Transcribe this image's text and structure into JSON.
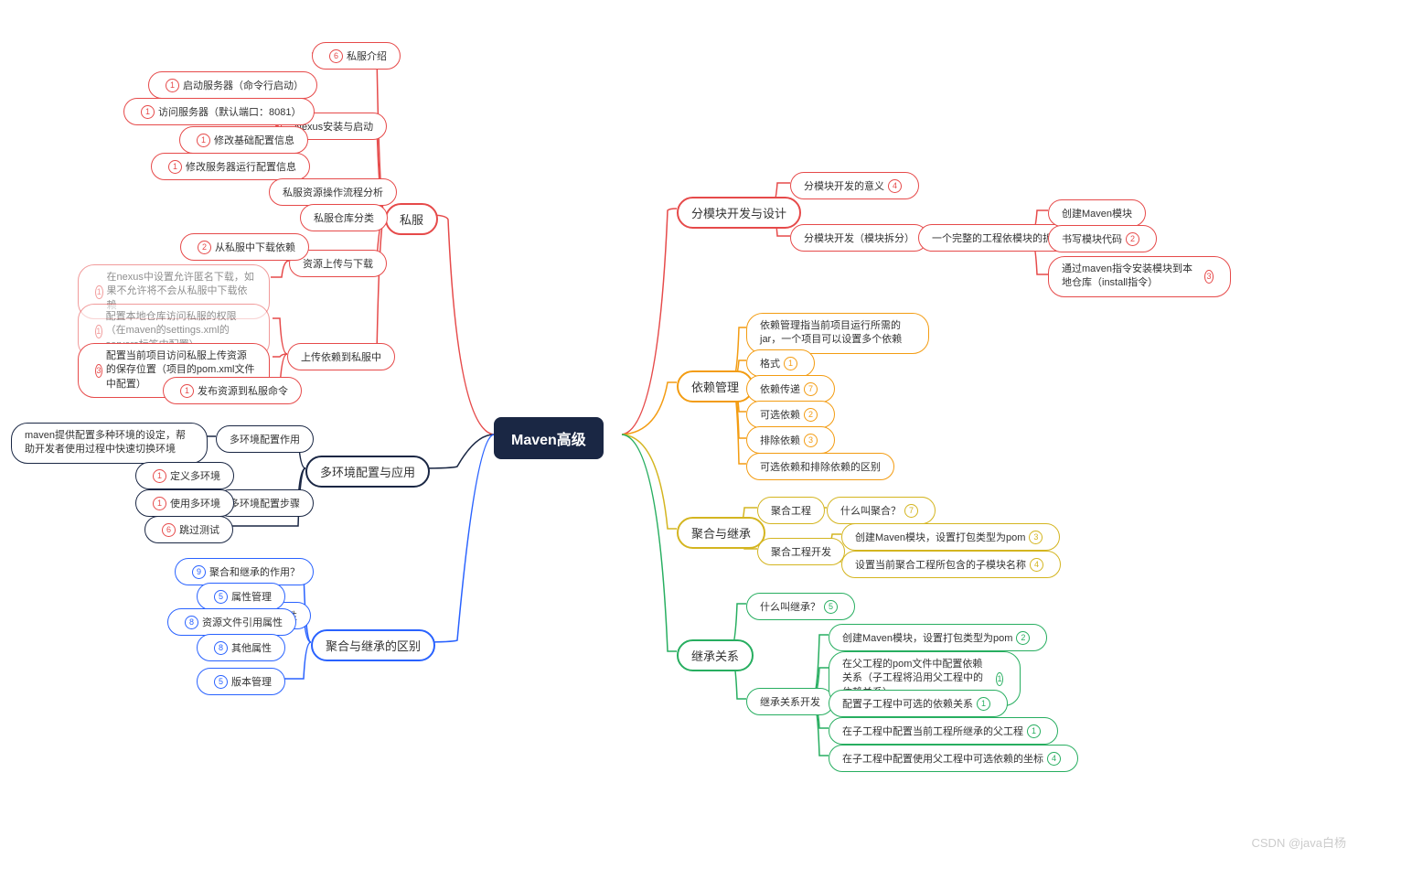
{
  "root": "Maven高级",
  "watermark": "CSDN @java白杨",
  "private_server": {
    "title": "私服",
    "intro": "私服介绍",
    "nexus": {
      "title": "Nexus安装与启动",
      "start": "启动服务器（命令行启动）",
      "access": "访问服务器（默认端口：8081）",
      "modify_base": "修改基础配置信息",
      "modify_run": "修改服务器运行配置信息"
    },
    "flow": "私服资源操作流程分析",
    "category": "私服仓库分类",
    "updown": {
      "title": "资源上传与下载",
      "download": "从私服中下载依赖",
      "note": "在nexus中设置允许匿名下载，如果不允许将不会从私服中下载依赖"
    },
    "upload": {
      "title": "上传依赖到私服中",
      "local": "配置本地仓库访问私服的权限（在maven的settings.xml的servers标签中配置）",
      "proj": "配置当前项目访问私服上传资源的保存位置（项目的pom.xml文件中配置）",
      "publish": "发布资源到私服命令"
    }
  },
  "multi_env": {
    "title": "多环境配置与应用",
    "purpose": {
      "title": "多环境配置作用",
      "desc": "maven提供配置多种环境的设定，帮助开发者使用过程中快速切换环境"
    },
    "steps": {
      "title": "多环境配置步骤",
      "define": "定义多环境",
      "use": "使用多环境"
    },
    "skip": "跳过测试"
  },
  "diff": {
    "title": "聚合与继承的区别",
    "purpose": "聚合和继承的作用？",
    "attr": {
      "title": "属性",
      "manage": "属性管理",
      "resource": "资源文件引用属性",
      "other": "其他属性"
    },
    "version": "版本管理"
  },
  "modular": {
    "title": "分模块开发与设计",
    "meaning": "分模块开发的意义",
    "dev": {
      "title": "分模块开发（模块拆分）",
      "split": "一个完整的工程依模块的拆分",
      "create": "创建Maven模块",
      "write": "书写模块代码",
      "install": "通过maven指令安装模块到本地仓库（install指令）"
    }
  },
  "dep": {
    "title": "依赖管理",
    "desc": "依赖管理指当前项目运行所需的jar，一个项目可以设置多个依赖",
    "format": "格式",
    "transitive": "依赖传递",
    "optional": "可选依赖",
    "exclude": "排除依赖",
    "diff": "可选依赖和排除依赖的区别"
  },
  "aggregate": {
    "title": "聚合与继承",
    "proj": "聚合工程",
    "what": "什么叫聚合？",
    "dev": "聚合工程开发",
    "create": "创建Maven模块，设置打包类型为pom",
    "set": "设置当前聚合工程所包含的子模块名称"
  },
  "inherit": {
    "title": "继承关系",
    "what": "什么叫继承？",
    "dev": "继承关系开发",
    "create": "创建Maven模块，设置打包类型为pom",
    "parent_dep": "在父工程的pom文件中配置依赖关系（子工程将沿用父工程中的依赖关系）",
    "child_opt": "配置子工程中可选的依赖关系",
    "child_parent": "在子工程中配置当前工程所继承的父工程",
    "child_coord": "在子工程中配置使用父工程中可选依赖的坐标"
  }
}
